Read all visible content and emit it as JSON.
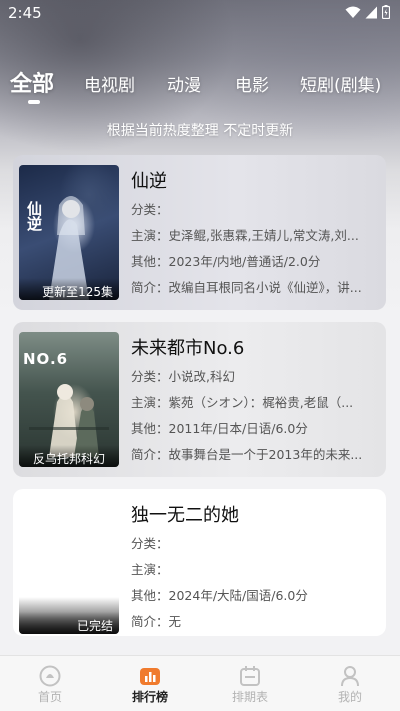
{
  "status_bar": {
    "time": "2:45"
  },
  "tabs": [
    {
      "label": "全部",
      "active": true
    },
    {
      "label": "电视剧",
      "active": false
    },
    {
      "label": "动漫",
      "active": false
    },
    {
      "label": "电影",
      "active": false
    },
    {
      "label": "短剧(剧集)",
      "active": false
    }
  ],
  "subtitle": "根据当前热度整理 不定时更新",
  "labels": {
    "category": "分类：",
    "cast": "主演：",
    "other": "其他：",
    "intro": "简介："
  },
  "items": [
    {
      "title": "仙逆",
      "category": "",
      "cast": "史泽鲲,张惠霖,王婧儿,常文涛,刘...",
      "other": "2023年/内地/普通话/2.0分",
      "intro": "改编自耳根同名小说《仙逆》，讲...",
      "poster_badge": "更新至125集",
      "poster_art_text": "仙逆"
    },
    {
      "title": "未来都市No.6",
      "category": "小说改,科幻",
      "cast": "紫苑（シオン）：梶裕贵,老鼠（...",
      "other": "2011年/日本/日语/6.0分",
      "intro": "故事舞台是一个于2013年的未来...",
      "poster_badge": "反乌托邦科幻",
      "poster_art_text": "NO.6"
    },
    {
      "title": "独一无二的她",
      "category": "",
      "cast": "",
      "other": "2024年/大陆/国语/6.0分",
      "intro": "无",
      "poster_badge": "已完结"
    }
  ],
  "bottom_nav": [
    {
      "label": "首页",
      "icon": "home-icon",
      "active": false
    },
    {
      "label": "排行榜",
      "icon": "ranking-icon",
      "active": true
    },
    {
      "label": "排期表",
      "icon": "calendar-icon",
      "active": false
    },
    {
      "label": "我的",
      "icon": "profile-icon",
      "active": false
    }
  ],
  "colors": {
    "active_nav": "#222222",
    "inactive_nav": "#b3b3b3",
    "card_bg": "#ffffff"
  }
}
